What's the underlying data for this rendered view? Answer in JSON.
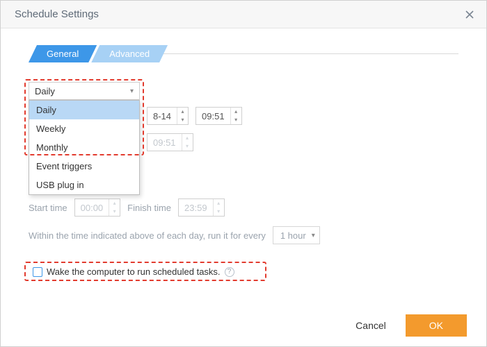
{
  "title": "Schedule Settings",
  "tabs": {
    "general": "General",
    "advanced": "Advanced"
  },
  "frequency": {
    "selected": "Daily",
    "options": [
      "Daily",
      "Weekly",
      "Monthly",
      "Event triggers",
      "USB plug in"
    ]
  },
  "residual": {
    "date_fragment": "8-14",
    "time_once": "09:51",
    "time_second": "09:51"
  },
  "start": {
    "label": "Start time",
    "value": "00:00"
  },
  "finish": {
    "label": "Finish time",
    "value": "23:59"
  },
  "interval": {
    "text": "Within the time indicated above of each day, run it for every",
    "value": "1 hour"
  },
  "wake": {
    "label": "Wake the computer to run scheduled tasks."
  },
  "footer": {
    "cancel": "Cancel",
    "ok": "OK"
  }
}
